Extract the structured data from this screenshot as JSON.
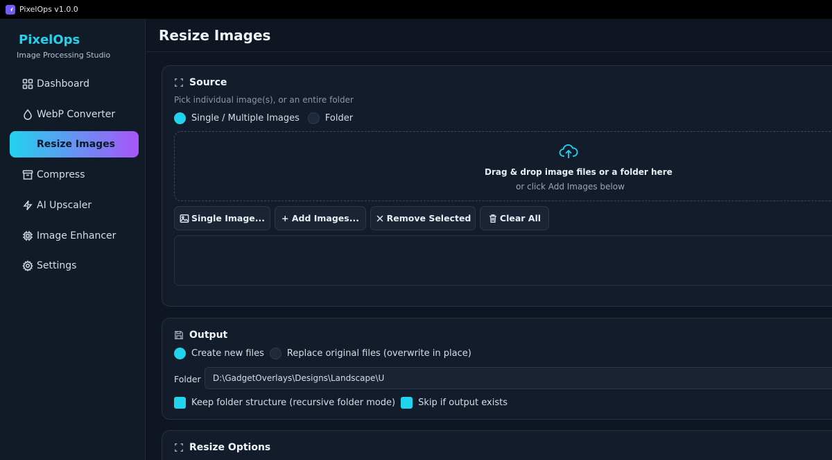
{
  "window": {
    "title": "PixelOps v1.0.0"
  },
  "sidebar": {
    "brand": "PixelOps",
    "subtitle": "Image Processing Studio",
    "items": [
      {
        "label": "Dashboard",
        "icon": "grid-icon"
      },
      {
        "label": "WebP Converter",
        "icon": "droplet-icon"
      },
      {
        "label": "Resize Images",
        "icon": "resize-icon",
        "active": true
      },
      {
        "label": "Compress",
        "icon": "archive-icon"
      },
      {
        "label": "AI Upscaler",
        "icon": "zap-icon"
      },
      {
        "label": "Image Enhancer",
        "icon": "chip-icon"
      },
      {
        "label": "Settings",
        "icon": "gear-icon"
      }
    ]
  },
  "main": {
    "page_title": "Resize Images",
    "source": {
      "title": "Source",
      "description": "Pick individual image(s), or an entire folder",
      "mode_single": "Single / Multiple Images",
      "mode_folder": "Folder",
      "dropzone_title": "Drag & drop image files or a folder here",
      "dropzone_sub": "or click Add Images below",
      "buttons": {
        "single_image": "Single Image...",
        "add_images": "+ Add Images...",
        "remove_selected": "Remove Selected",
        "clear_all": "Clear All"
      }
    },
    "output": {
      "title": "Output",
      "mode_new": "Create new files",
      "mode_replace": "Replace original files (overwrite in place)",
      "folder_label": "Folder",
      "folder_value": "D:\\GadgetOverlays\\Designs\\Landscape\\U",
      "keep_structure": "Keep folder structure (recursive folder mode)",
      "skip_existing": "Skip if output exists"
    },
    "resize_options": {
      "title": "Resize Options"
    }
  },
  "colors": {
    "accent": "#22d3ee",
    "accent2": "#a855f7",
    "background": "#0f1622",
    "card": "#131c2a"
  }
}
